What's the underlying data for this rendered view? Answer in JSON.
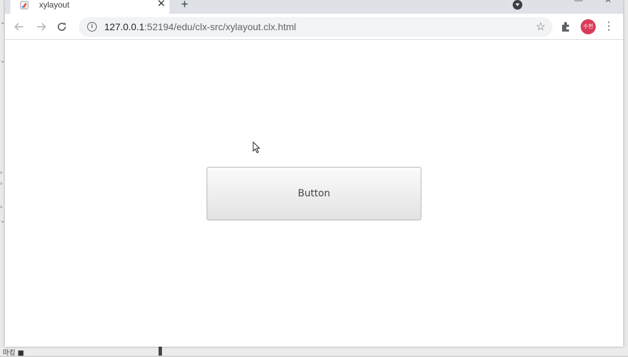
{
  "browser": {
    "tab_title": "xylayout",
    "tab_close_glyph": "✕",
    "new_tab_glyph": "+",
    "url_host": "127.0.0.1",
    "url_rest": ":52194/edu/clx-src/xylayout.clx.html",
    "profile_initials": "수현",
    "menu_glyph": "⋮",
    "star_glyph": "☆"
  },
  "page": {
    "button_label": "Button"
  },
  "background": {
    "bottom_text": "마킹 ■"
  },
  "colors": {
    "tabstrip": "#dee1e6",
    "omnibox": "#f1f3f4",
    "avatar": "#d93a58"
  }
}
